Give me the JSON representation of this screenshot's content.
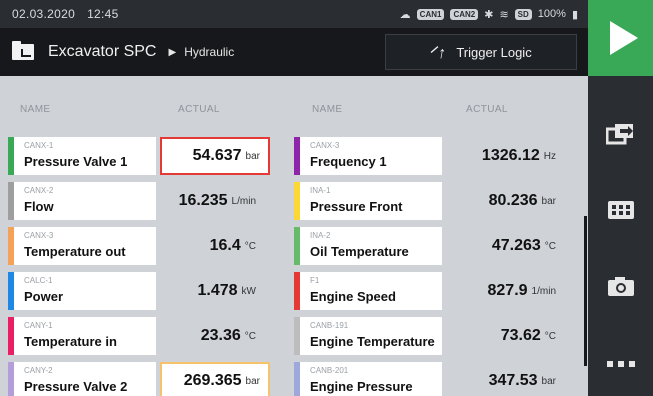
{
  "status": {
    "date": "02.03.2020",
    "time": "12:45",
    "can1": "CAN1",
    "can2": "CAN2",
    "sd": "SD",
    "battery": "100%"
  },
  "title": {
    "project": "Excavator SPC",
    "subproject": "Hydraulic",
    "trigger_label": "Trigger Logic"
  },
  "table": {
    "headers": {
      "name_left": "NAME",
      "actual_left": "ACTUAL",
      "name_right": "NAME",
      "actual_right": "ACTUAL"
    }
  },
  "rows": [
    {
      "left": {
        "channel": "CANX-1",
        "name": "Pressure Valve 1",
        "value": "54.637",
        "unit": "bar",
        "color": "#3aa957",
        "highlight": "#e53935"
      },
      "right": {
        "channel": "CANX-3",
        "name": "Frequency 1",
        "value": "1326.12",
        "unit": "Hz",
        "color": "#8e24aa",
        "highlight": ""
      }
    },
    {
      "left": {
        "channel": "CANX-2",
        "name": "Flow",
        "value": "16.235",
        "unit": "L/min",
        "color": "#9e9e9e",
        "highlight": ""
      },
      "right": {
        "channel": "INA-1",
        "name": "Pressure Front",
        "value": "80.236",
        "unit": "bar",
        "color": "#fdd835",
        "highlight": ""
      }
    },
    {
      "left": {
        "channel": "CANX-3",
        "name": "Temperature out",
        "value": "16.4",
        "unit": "°C",
        "color": "#f4a259",
        "highlight": ""
      },
      "right": {
        "channel": "INA-2",
        "name": "Oil Temperature",
        "value": "47.263",
        "unit": "°C",
        "color": "#66bb6a",
        "highlight": ""
      }
    },
    {
      "left": {
        "channel": "CALC-1",
        "name": "Power",
        "value": "1.478",
        "unit": "kW",
        "color": "#1e88e5",
        "highlight": ""
      },
      "right": {
        "channel": "F1",
        "name": "Engine Speed",
        "value": "827.9",
        "unit": "1/min",
        "color": "#e53935",
        "highlight": ""
      }
    },
    {
      "left": {
        "channel": "CANY-1",
        "name": "Temperature in",
        "value": "23.36",
        "unit": "°C",
        "color": "#e91e63",
        "highlight": ""
      },
      "right": {
        "channel": "CANB-191",
        "name": "Engine Temperature",
        "value": "73.62",
        "unit": "°C",
        "color": "#bdbdbd",
        "highlight": ""
      }
    },
    {
      "left": {
        "channel": "CANY-2",
        "name": "Pressure Valve 2",
        "value": "269.365",
        "unit": "bar",
        "color": "#b39ddb",
        "highlight": "#f6c26b"
      },
      "right": {
        "channel": "CANB-201",
        "name": "Engine Pressure",
        "value": "347.53",
        "unit": "bar",
        "color": "#9fa8da",
        "highlight": ""
      }
    }
  ],
  "sidebar": {
    "icons": [
      "export-icon",
      "keypad-icon",
      "camera-icon",
      "more-icon"
    ]
  },
  "colors": {
    "play": "#3aa957",
    "sidebar": "#2a2d31",
    "content": "#cfd3d8"
  }
}
